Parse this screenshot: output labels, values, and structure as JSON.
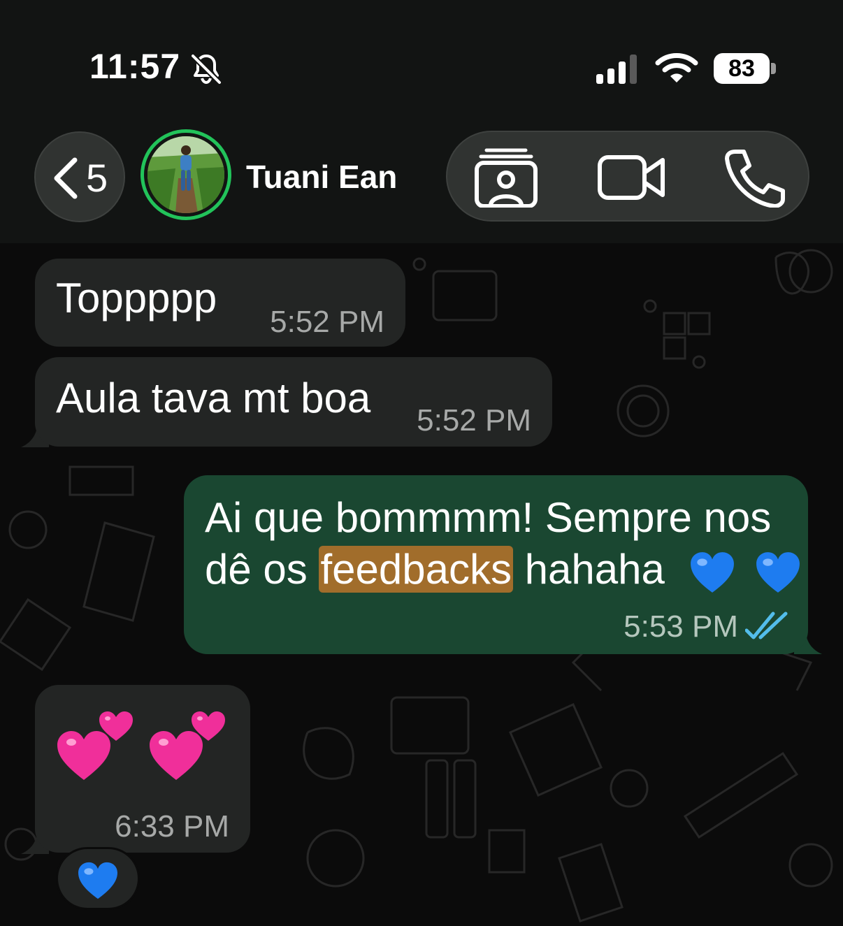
{
  "status_bar": {
    "time": "11:57",
    "battery_level": "83",
    "icons": [
      "bell-slash-icon",
      "cellular-signal-icon",
      "wifi-icon",
      "battery-icon"
    ]
  },
  "header": {
    "back_count": "5",
    "contact_name": "Tuani Ean",
    "actions": [
      "contact-card-icon",
      "video-call-icon",
      "phone-call-icon"
    ]
  },
  "messages": [
    {
      "direction": "incoming",
      "text": "Toppppp",
      "time": "5:52 PM"
    },
    {
      "direction": "incoming",
      "text": "Aula tava mt boa",
      "time": "5:52 PM"
    },
    {
      "direction": "outgoing",
      "line1": "Ai que bommmm! Sempre nos",
      "line2_before": "dê os ",
      "line2_highlight": "feedbacks",
      "line2_after": " hahaha",
      "emoji": [
        "blue-heart",
        "blue-heart"
      ],
      "time": "5:53 PM",
      "status": "read"
    },
    {
      "direction": "incoming",
      "emoji": [
        "two-hearts",
        "two-hearts"
      ],
      "time": "6:33 PM",
      "reaction": "blue-heart"
    }
  ],
  "colors": {
    "incoming_bubble": "#232524",
    "outgoing_bubble": "#1a4731",
    "highlight": "#a16d2b",
    "read_ticks": "#53bdeb",
    "avatar_ring": "#22c35a"
  }
}
